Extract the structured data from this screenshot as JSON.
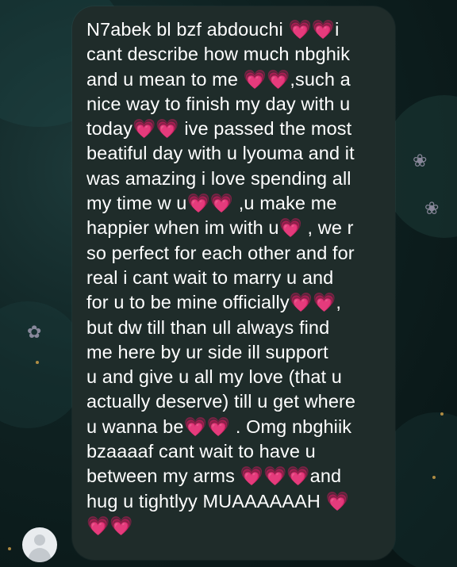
{
  "chat": {
    "message": "N7abek bl bzf abdouchi 💗💗i\ncant describe how much nbghik\nand u mean to me 💗💗,such a\nnice way to finish my day with u\ntoday💗💗 ive passed the most\nbeatiful day with u lyouma and it\nwas amazing i love spending all\nmy time w u💗💗 ,u make me\nhappier when im with u💗 , we r\nso perfect for each other and for\nreal i cant wait to marry u and\nfor u to be mine officially💗💗,\nbut dw till than ull always find\nme here by ur side ill support\nu and give u all my love (that u\nactually deserve) till u get where\nu wanna be💗💗 . Omg nbghiik\nbzaaaaf cant wait to have u\nbetween my arms 💗💗💗and\nhug u tightlyy MUAAAAAAH 💗\n💗💗",
    "sender_avatar_icon": "default-user-avatar-icon",
    "bubble_color": "#1f2c2a",
    "text_color": "#ffffff"
  }
}
